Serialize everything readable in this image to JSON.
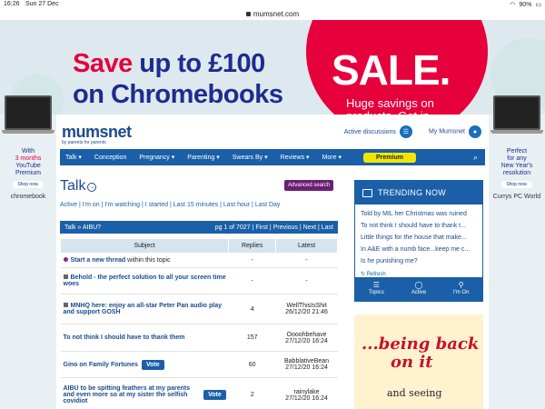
{
  "status": {
    "time": "16:26",
    "date": "Sun 27 Dec",
    "battery": "90%"
  },
  "browser": {
    "url": "mumsnet.com"
  },
  "top_ad": {
    "line1_accent": "Save",
    "line1_rest": " up to £100",
    "line2": "on Chromebooks",
    "sale": "SALE.",
    "sale_sub": "Huge savings on products. Get in."
  },
  "left_ad": {
    "line1": "With",
    "line2": "3 months",
    "line3": "YouTube",
    "line4": "Premium",
    "button": "Shop now.",
    "brand": "chromebook"
  },
  "right_side_ad": {
    "line1": "Perfect",
    "line2": "for any",
    "line3": "New Year's",
    "line4": "resolution",
    "button": "Shop now.",
    "brand": "Currys PC World"
  },
  "header": {
    "logo": "mumsnet",
    "tagline": "by parents for parents",
    "active_discussions": "Active discussions",
    "my_mumsnet": "My Mumsnet"
  },
  "nav": {
    "items": [
      "Talk",
      "Conception",
      "Pregnancy",
      "Parenting",
      "Swears By",
      "Reviews",
      "More"
    ],
    "premium": "Premium"
  },
  "talk": {
    "title": "Talk",
    "advanced_search": "Advanced search",
    "links": [
      "Active",
      "I'm on",
      "I'm watching",
      "I started",
      "Last 15 minutes",
      "Last hour",
      "Last Day"
    ],
    "breadcrumb": "Talk » AIBU?",
    "pager": {
      "page_info": "pg 1 of 7027",
      "first": "First",
      "previous": "Previous",
      "next": "Next",
      "last": "Last"
    },
    "columns": [
      "Subject",
      "Replies",
      "Latest"
    ],
    "rows": [
      {
        "subject": "Start a new thread",
        "suffix": " within this topic",
        "replies": "-",
        "latest_user": "-",
        "latest_time": ""
      },
      {
        "subject": "Behold - the perfect solution to all your screen time woes",
        "replies": "-",
        "latest_user": "-",
        "latest_time": ""
      },
      {
        "subject": "MNHQ here: enjoy an all-star Peter Pan audio play and support GOSH",
        "replies": "4",
        "latest_user": "WellThisIsShit",
        "latest_time": "26/12/20 21:46"
      },
      {
        "subject": "To not think I should have to thank them",
        "replies": "157",
        "latest_user": "Oooohbehave",
        "latest_time": "27/12/20 16:24"
      },
      {
        "subject": "Gino on Family Fortunes",
        "vote": "Vote",
        "replies": "60",
        "latest_user": "BabblativeBean",
        "latest_time": "27/12/20 16:24"
      },
      {
        "subject": "AIBU to be spitting feathers at my parents and even more so at my sister the selfish covidiot",
        "vote": "Vote",
        "replies": "2",
        "latest_user": "rainylake",
        "latest_time": "27/12/20 16:24"
      }
    ]
  },
  "trending": {
    "title": "TRENDING NOW",
    "items": [
      "Told by MIL her Christmas was ruined",
      "To not think I should have to thank t...",
      "Little things for the house that make...",
      "In A&E with a numb face...keep me c...",
      "Is he punishing me?"
    ],
    "refresh": "Refresh",
    "tabs": [
      "Topics",
      "Active",
      "I'm On"
    ]
  },
  "right_ad": {
    "line1": "...being back",
    "line2": "on it",
    "line3": "and seeing"
  }
}
